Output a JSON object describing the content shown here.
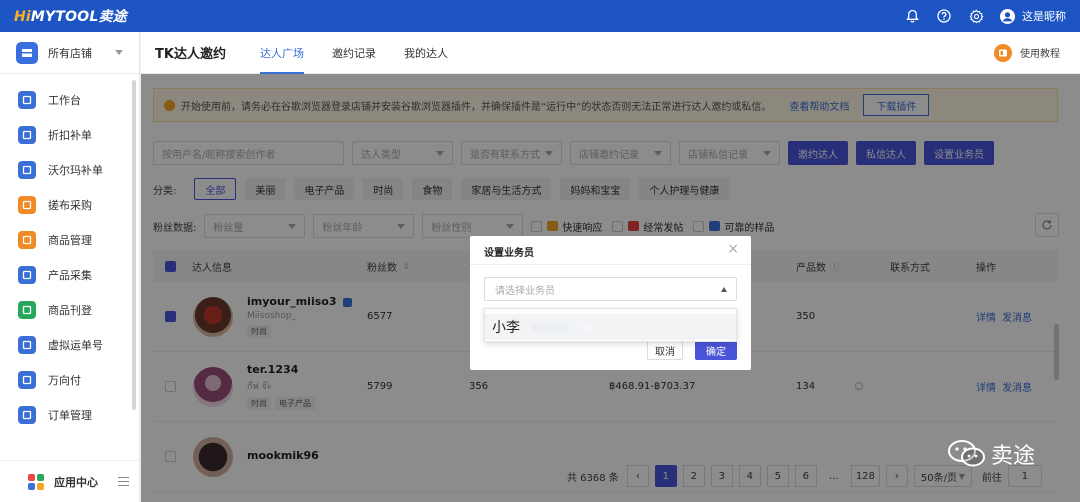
{
  "topbar": {
    "logo_prefix": "Hi",
    "logo_main": "MYTOOL卖途",
    "user_name": "这是昵称",
    "icons": [
      "bell-icon",
      "help-icon",
      "gear-icon",
      "user-icon"
    ]
  },
  "sidebar": {
    "store": "所有店铺",
    "items": [
      {
        "label": "工作台",
        "color": "#3a6fd8"
      },
      {
        "label": "折扣补单",
        "color": "#3a6fd8"
      },
      {
        "label": "沃尔玛补单",
        "color": "#3a6fd8"
      },
      {
        "label": "搓布采购",
        "color": "#f08a24"
      },
      {
        "label": "商品管理",
        "color": "#f08a24"
      },
      {
        "label": "产品采集",
        "color": "#3a6fd8"
      },
      {
        "label": "商品刊登",
        "color": "#27a95c"
      },
      {
        "label": "虚拟运单号",
        "color": "#3a6fd8"
      },
      {
        "label": "万向付",
        "color": "#3a6fd8"
      },
      {
        "label": "订单管理",
        "color": "#3a6fd8"
      }
    ],
    "app_center": "应用中心"
  },
  "header": {
    "title": "TK达人邀约",
    "tabs": [
      "达人广场",
      "邀约记录",
      "我的达人"
    ],
    "active_tab": 0,
    "help": "使用教程"
  },
  "notice": {
    "text": "开始使用前，请务必在谷歌浏览器登录店铺并安装谷歌浏览器插件，并确保插件是“运行中”的状态否则无法正常进行达人邀约或私信。",
    "doc_link": "查看帮助文档",
    "download": "下载插件"
  },
  "filters": {
    "search_placeholder": "按用户名/昵称搜索创作者",
    "type": "达人类型",
    "contact": "是否有联系方式",
    "invite_record": "店铺邀约记录",
    "private_record": "店铺私信记录",
    "btn_invite": "邀约达人",
    "btn_message": "私信达人",
    "btn_assign": "设置业务员"
  },
  "categories": {
    "label": "分类:",
    "items": [
      "全部",
      "美丽",
      "电子产品",
      "时尚",
      "食物",
      "家居与生活方式",
      "妈妈和宝宝",
      "个人护理与健康"
    ],
    "active": 0
  },
  "fans": {
    "label": "粉丝数据:",
    "fields": [
      "粉丝量",
      "粉丝年龄",
      "粉丝性别"
    ],
    "checks": [
      "快速响应",
      "经常发帖",
      "可靠的样品"
    ]
  },
  "table": {
    "headers": {
      "info": "达人信息",
      "fans": "粉丝数",
      "products": "产品数",
      "contact": "联系方式",
      "actions": "操作"
    },
    "rows": [
      {
        "name": "imyour_miiso3",
        "sub": "Miisoshop_",
        "tags": [
          "时尚"
        ],
        "fans": "6577",
        "col3": "",
        "col4": "",
        "products": "350",
        "checked": true
      },
      {
        "name": "ter.1234",
        "sub": "ก๊ฟ จ๊ะ",
        "tags": [
          "时尚",
          "电子产品"
        ],
        "fans": "5799",
        "col3": "356",
        "col4": "฿468.91-฿703.37",
        "products": "134",
        "checked": false
      },
      {
        "name": "mookmik96",
        "sub": "",
        "tags": [],
        "fans": "",
        "col3": "",
        "col4": "",
        "products": "",
        "checked": false
      }
    ],
    "action_detail": "详情",
    "action_message": "发消息"
  },
  "pager": {
    "total": "共 6368 条",
    "pages": [
      "1",
      "2",
      "3",
      "4",
      "5",
      "6",
      "...",
      "128"
    ],
    "current": "1",
    "size": "50条/页",
    "goto": "前往",
    "goto_value": "1"
  },
  "modal": {
    "title": "设置业务员",
    "placeholder": "请选择业务员",
    "option": "小李",
    "cancel": "取消",
    "ok": "确定"
  },
  "watermark": {
    "text": "卖途"
  },
  "colors": {
    "topbar": "#1d55c4",
    "primary": "#4a55d9",
    "link": "#3a6fd8",
    "logo_accent": "#ffb020"
  }
}
